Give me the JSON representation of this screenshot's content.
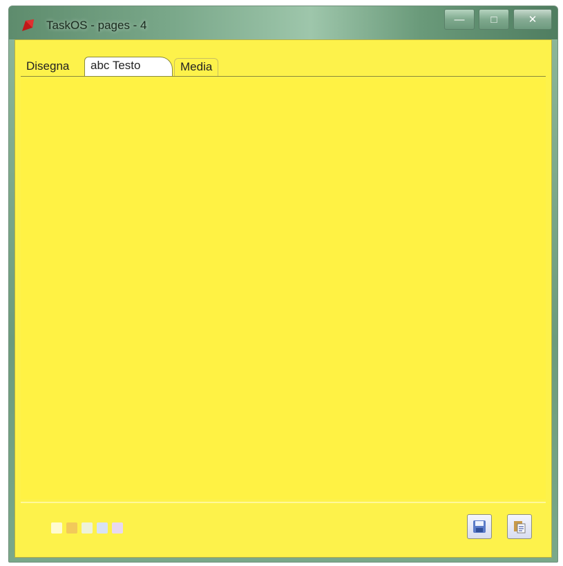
{
  "window": {
    "title": "TaskOS - pages - 4"
  },
  "caption": {
    "minimize_glyph": "—",
    "maximize_glyph": "□",
    "close_glyph": "✕"
  },
  "tabs": [
    {
      "label": "Disegna"
    },
    {
      "label": "abc Testo"
    },
    {
      "label": "Media"
    }
  ],
  "footer": {
    "swatch_colors": [
      "#fffbd0",
      "#f2c95a",
      "#eef2d8",
      "#d8e2f4",
      "#e8d8f0"
    ],
    "buttons": [
      "save-icon",
      "paste-icon"
    ]
  },
  "colors": {
    "note_background": "#fdf24b",
    "titlebar": "#7aa88a"
  }
}
